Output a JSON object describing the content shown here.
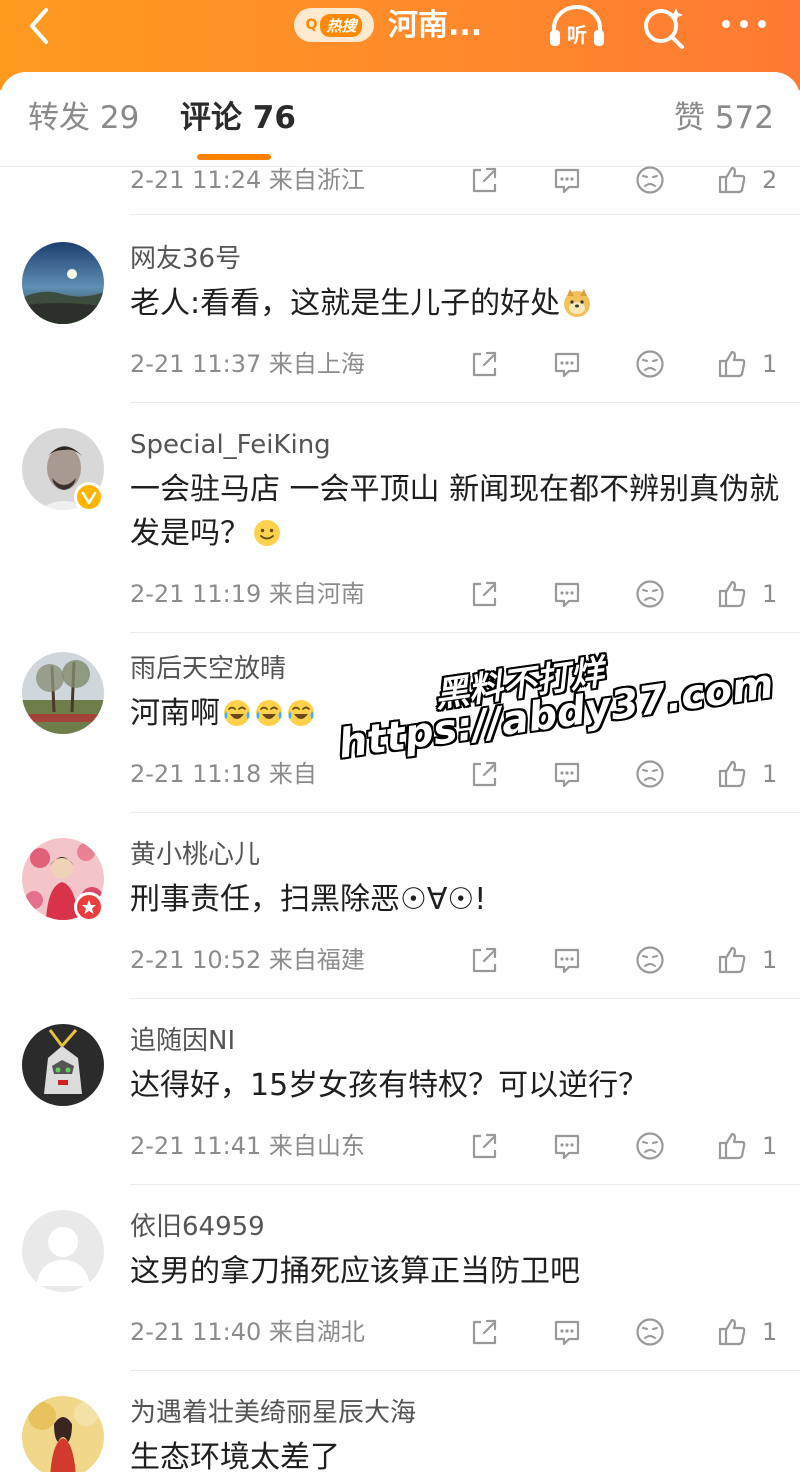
{
  "header": {
    "hot_badge_q": "Q",
    "hot_badge_text": "热搜",
    "title": "河南...",
    "listen_label": "听"
  },
  "tabs": {
    "repost": "转发 29",
    "comment": "评论 76",
    "like": "赞 572"
  },
  "colors": {
    "accent": "#ff8200",
    "header_bg": "#ff8a2b"
  },
  "partial_meta": {
    "time_location": "2-21 11:24  来自浙江",
    "likes": "2"
  },
  "comments": [
    {
      "username": "网友36号",
      "text": "老人:看看，这就是生儿子的好处",
      "emojis": [
        "doge"
      ],
      "time_location": "2-21 11:37  来自上海",
      "likes": "1"
    },
    {
      "username": "Special_FeiKing",
      "text": "一会驻马店 一会平顶山 新闻现在都不辨别真伪就发是吗？",
      "emojis": [
        "smile"
      ],
      "time_location": "2-21 11:19  来自河南",
      "likes": "1",
      "badge": "verified"
    },
    {
      "username": "雨后天空放晴",
      "text": "河南啊",
      "emojis": [
        "laugh-cry",
        "laugh-cry",
        "laugh-cry"
      ],
      "time_location": "2-21 11:18  来自",
      "likes": "1"
    },
    {
      "username": "黄小桃心儿",
      "text": "刑事责任，扫黑除恶☉∀☉!",
      "emojis": [],
      "time_location": "2-21 10:52  来自福建",
      "likes": "1",
      "badge": "red-star"
    },
    {
      "username": "追随因NI",
      "text": "达得好，15岁女孩有特权？可以逆行？",
      "emojis": [],
      "time_location": "2-21 11:41  来自山东",
      "likes": "1"
    },
    {
      "username": "依旧64959",
      "text": "这男的拿刀捅死应该算正当防卫吧",
      "emojis": [],
      "time_location": "2-21 11:40  来自湖北",
      "likes": "1"
    },
    {
      "username": "为遇着壮美绮丽星辰大海",
      "text": "生态环境太差了",
      "emojis": []
    }
  ],
  "watermark": {
    "line1": "黑料不打烊",
    "line2": "https://abdy37.com"
  }
}
